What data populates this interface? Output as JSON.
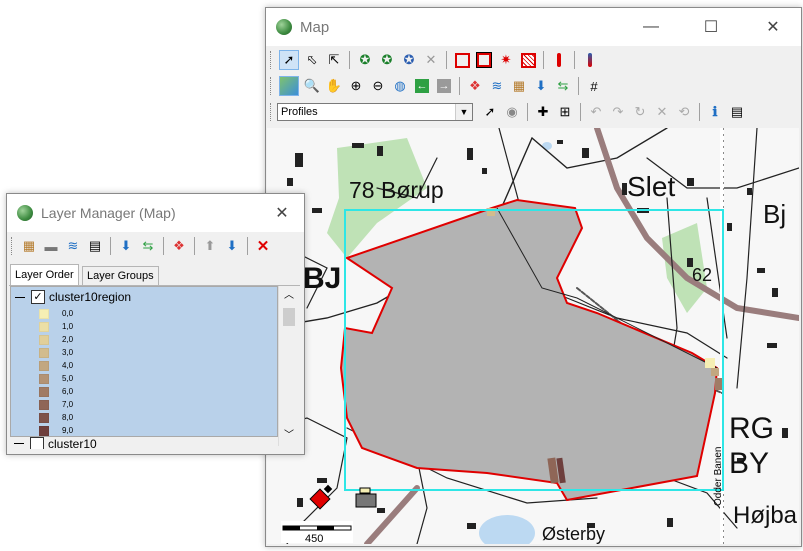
{
  "map_window": {
    "title": "Map",
    "minimize_glyph": "—",
    "maximize_glyph": "☐",
    "close_glyph": "✕",
    "profile_select": {
      "value": "Profiles"
    },
    "map": {
      "labels": {
        "borup": "78 Børup",
        "slet": "Slet",
        "bj": "Bj",
        "n62": "62",
        "bjb": "BJ",
        "rg": "RG",
        "by": "BY",
        "hojba": "Højba",
        "osterby": "Østerby",
        "railway": "Odder Banen"
      },
      "scale_value": "450",
      "colors": {
        "region_fill": "#b3b3b3",
        "region_outline": "#e00000",
        "selection_box": "#2ee6e6",
        "road": "#9a7d7d",
        "forest": "#bfe2b6"
      }
    }
  },
  "layer_manager": {
    "title": "Layer Manager (Map)",
    "close_glyph": "✕",
    "tabs": [
      {
        "label": "Layer Order",
        "active": true
      },
      {
        "label": "Layer Groups",
        "active": false
      }
    ],
    "layers": [
      {
        "name": "cluster10region",
        "checked": true,
        "expanded": true,
        "categories": [
          {
            "label": "0,0",
            "color": "#f6efb4"
          },
          {
            "label": "1,0",
            "color": "#ecdfa6"
          },
          {
            "label": "2,0",
            "color": "#e1cf99"
          },
          {
            "label": "3,0",
            "color": "#d2bc8d"
          },
          {
            "label": "4,0",
            "color": "#c2a780"
          },
          {
            "label": "5,0",
            "color": "#b39375"
          },
          {
            "label": "6,0",
            "color": "#a07b65"
          },
          {
            "label": "7,0",
            "color": "#8f6657"
          },
          {
            "label": "8,0",
            "color": "#7e524a"
          },
          {
            "label": "9,0",
            "color": "#6e3f3d"
          }
        ]
      },
      {
        "name": "cluster10",
        "checked": false,
        "expanded": true
      }
    ]
  }
}
